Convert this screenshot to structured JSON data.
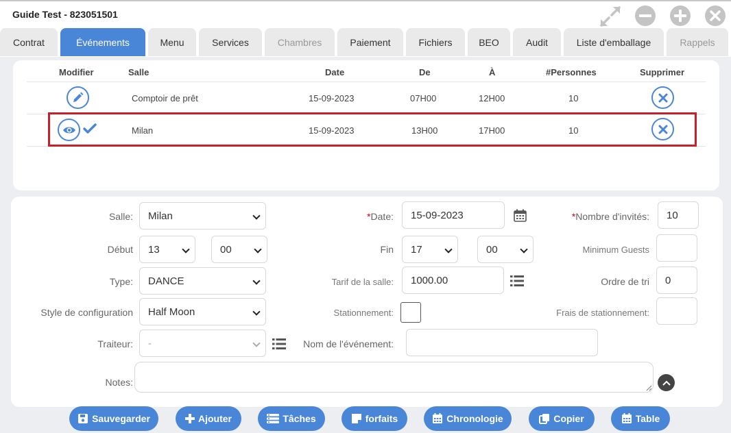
{
  "window": {
    "title": "Guide Test - 823051501"
  },
  "tabs": [
    {
      "label": "Contrat"
    },
    {
      "label": "Événements"
    },
    {
      "label": "Menu"
    },
    {
      "label": "Services"
    },
    {
      "label": "Chambres"
    },
    {
      "label": "Paiement"
    },
    {
      "label": "Fichiers"
    },
    {
      "label": "BEO"
    },
    {
      "label": "Audit"
    },
    {
      "label": "Liste d'emballage"
    },
    {
      "label": "Rappels"
    }
  ],
  "active_tab": "Événements",
  "events_table": {
    "headers": [
      "Modifier",
      "Salle",
      "Date",
      "De",
      "À",
      "#Personnes",
      "Supprimer"
    ],
    "rows": [
      {
        "salle": "Comptoir de prêt",
        "date": "15-09-2023",
        "de": "07H00",
        "a": "12H00",
        "personnes": "10",
        "action_icon": "pencil-icon",
        "selected": false
      },
      {
        "salle": "Milan",
        "date": "15-09-2023",
        "de": "13H00",
        "a": "17H00",
        "personnes": "10",
        "action_icon": "eye-icon",
        "selected": true
      }
    ]
  },
  "form": {
    "salle": {
      "label": "Salle:",
      "value": "Milan"
    },
    "date": {
      "required_mark": "*",
      "label": "Date:",
      "value": "15-09-2023"
    },
    "nombre_invites": {
      "required_mark": "*",
      "label": "Nombre d'invités:",
      "value": "10"
    },
    "debut": {
      "label": "Début",
      "hour": "13",
      "minute": "00"
    },
    "fin": {
      "label": "Fin",
      "hour": "17",
      "minute": "00"
    },
    "minimum_guests": {
      "label": "Minimum Guests",
      "value": ""
    },
    "type": {
      "label": "Type:",
      "value": "DANCE"
    },
    "tarif_salle": {
      "label": "Tarif de la salle:",
      "value": "1000.00"
    },
    "ordre_tri": {
      "label": "Ordre de tri",
      "value": "0"
    },
    "style_configuration": {
      "label": "Style de configuration",
      "value": "Half Moon"
    },
    "stationnement": {
      "label": "Stationnement:",
      "checked": false
    },
    "frais_stationnement": {
      "label": "Frais de stationnement:",
      "value": ""
    },
    "traiteur": {
      "label": "Traiteur:",
      "value": "-"
    },
    "nom_evenement": {
      "label": "Nom de l'événement:",
      "value": ""
    },
    "notes": {
      "label": "Notes:",
      "value": ""
    }
  },
  "buttons": [
    {
      "label": "Sauvegarder",
      "icon": "save-icon"
    },
    {
      "label": "Ajouter",
      "icon": "plus-icon"
    },
    {
      "label": "Tâches",
      "icon": "tasks-icon"
    },
    {
      "label": "forfaits",
      "icon": "note-icon"
    },
    {
      "label": "Chronologie",
      "icon": "calendar-icon"
    },
    {
      "label": "Copier",
      "icon": "copy-icon"
    },
    {
      "label": "Table",
      "icon": "calendar-icon"
    }
  ],
  "colors": {
    "accent": "#4a86d8",
    "highlight_border": "#c8202a",
    "required": "#d0021b",
    "window_button": "#c4c4c4"
  }
}
